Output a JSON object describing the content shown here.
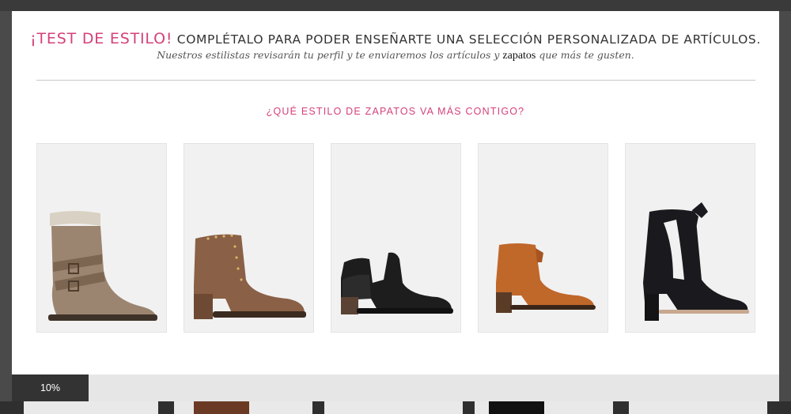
{
  "modal": {
    "title_accent": "¡Test de estilo!",
    "title_rest": "Complétalo para poder enseñarte una selección personalizada de artículos.",
    "subtitle_before": "Nuestros estilistas revisarán tu perfil y te enviaremos los artículos y",
    "subtitle_link": "zapatos",
    "subtitle_after": "que más te gusten.",
    "question": "¿Qué estilo de zapatos va más contigo?"
  },
  "options": [
    {
      "icon": "slouch-boot-with-buckles-icon",
      "color": "#9c8570"
    },
    {
      "icon": "studded-brown-ankle-boot-icon",
      "color": "#8a6046"
    },
    {
      "icon": "black-cutout-bootie-icon",
      "color": "#1d1d1d"
    },
    {
      "icon": "cognac-ankle-boot-icon",
      "color": "#c0672a"
    },
    {
      "icon": "black-heeled-bow-bootie-icon",
      "color": "#1a1a1e"
    }
  ],
  "progress": {
    "label": "10%",
    "fraction": 0.1
  },
  "colors": {
    "accent": "#d4417a",
    "progress_fill": "#333333",
    "progress_track": "#e6e6e6"
  }
}
